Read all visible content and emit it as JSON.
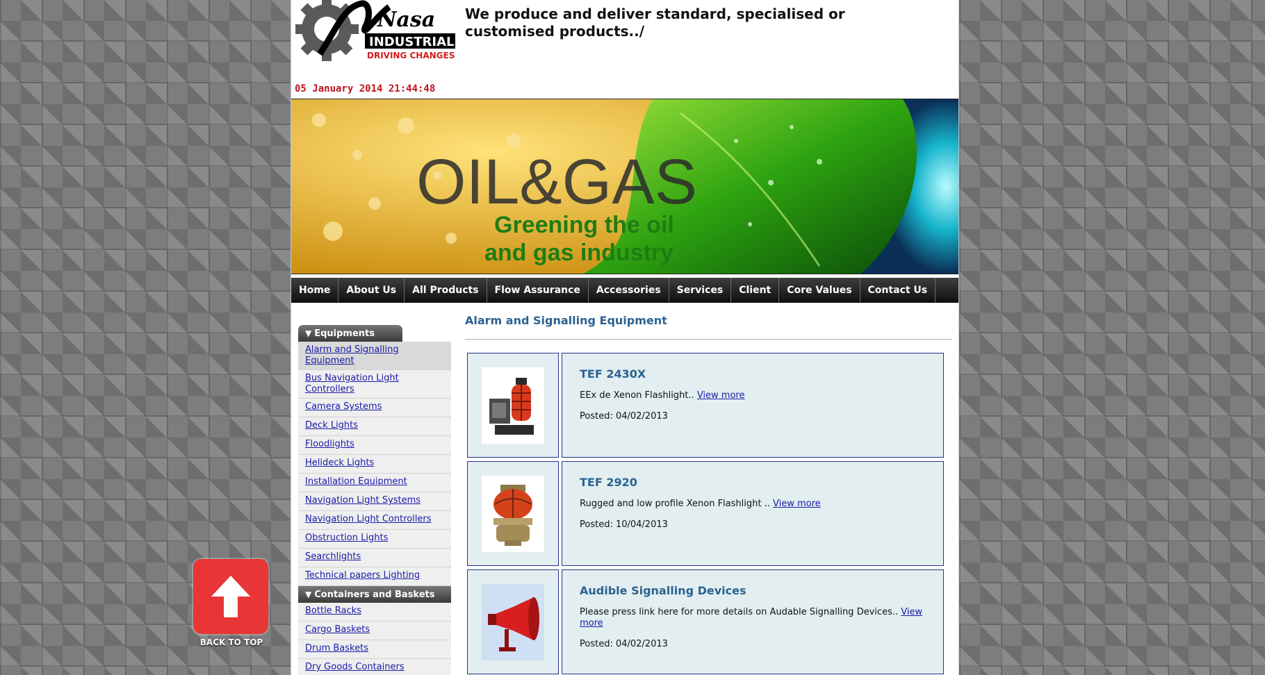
{
  "header": {
    "logo": {
      "brand": "Nasa",
      "line1": "INDUSTRIAL",
      "line2": "DRIVING CHANGES"
    },
    "tagline": "We produce and deliver standard, specialised or customised products../",
    "datetime": "05 January 2014 21:44:48"
  },
  "banner": {
    "title": "OIL&GAS",
    "subtitle_line1": "Greening the oil",
    "subtitle_line2": "and gas industry"
  },
  "nav": [
    "Home",
    "About Us",
    "All Products",
    "Flow Assurance",
    "Accessories",
    "Services",
    "Client",
    "Core Values",
    "Contact Us"
  ],
  "sidebar": {
    "categories": [
      {
        "label": "Equipments",
        "items": [
          "Alarm and Signalling Equipment",
          "Bus Navigation Light Controllers",
          "Camera Systems",
          "Deck Lights",
          "Floodlights",
          "Helideck Lights",
          "Installation Equipment",
          "Navigation Light Systems",
          "Navigation Light Controllers",
          "Obstruction Lights",
          "Searchlights",
          "Technical papers Lighting"
        ]
      },
      {
        "label": "Containers and Baskets",
        "items": [
          "Bottle Racks",
          "Cargo Baskets",
          "Drum Baskets",
          "Dry Goods Containers"
        ]
      }
    ]
  },
  "main": {
    "title": "Alarm and Signalling Equipment",
    "products": [
      {
        "title": "TEF 2430X",
        "desc": "EEx de Xenon Flashlight..",
        "link": "View more",
        "posted": "Posted: 04/02/2013"
      },
      {
        "title": "TEF 2920",
        "desc": "Rugged and low profile Xenon Flashlight ..",
        "link": "View more",
        "posted": "Posted: 10/04/2013"
      },
      {
        "title": "Audible Signalling Devices",
        "desc": "Please press link here for more details on Audable Signalling Devices..",
        "link": "View more",
        "posted": "Posted: 04/02/2013"
      }
    ]
  },
  "back_to_top": "BACK TO TOP",
  "colors": {
    "accent_blue": "#2c6291",
    "nav_dark": "#1a1a1a",
    "date_red": "#c0141c",
    "card_bg": "#e2eeef",
    "back_top_red": "#e83535"
  }
}
